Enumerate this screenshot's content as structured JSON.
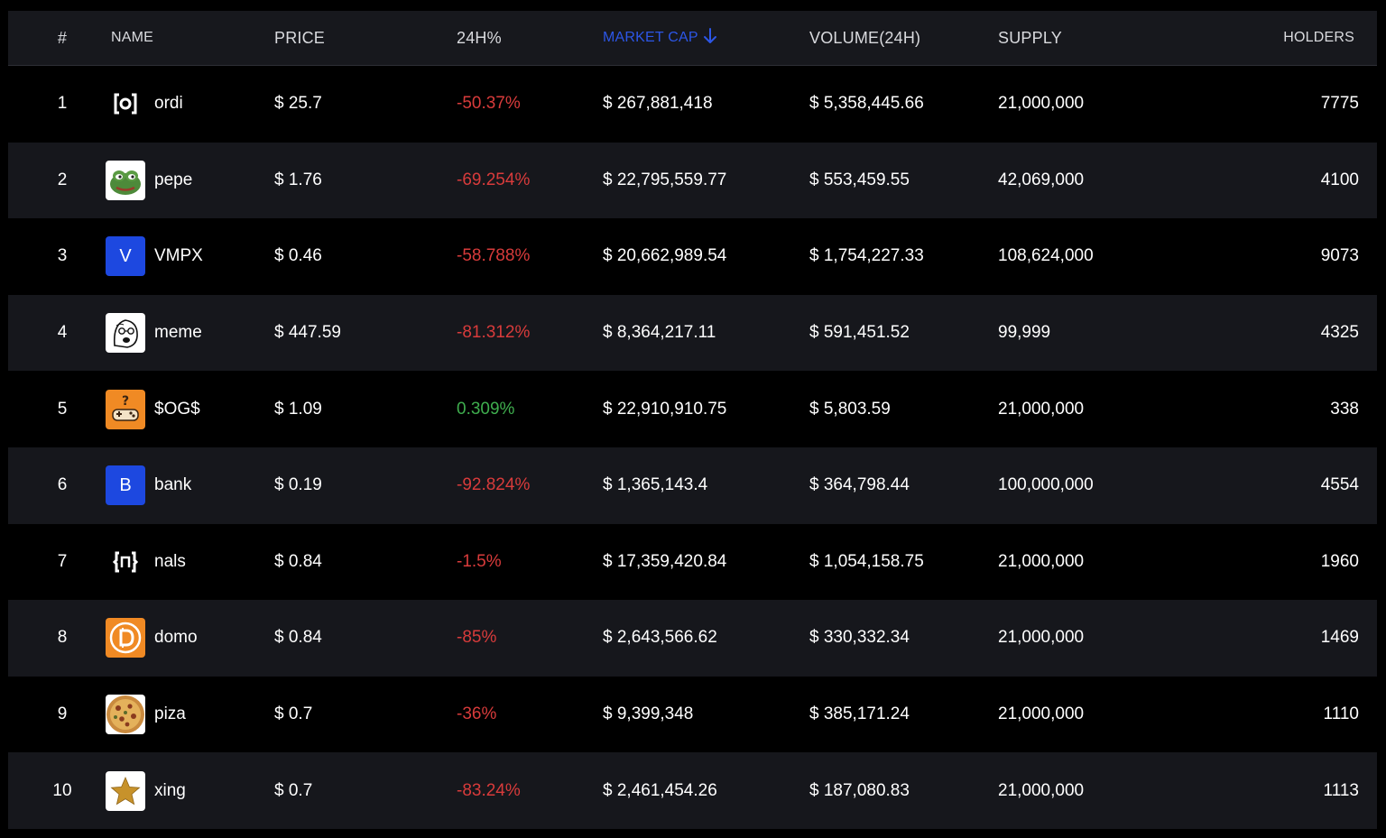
{
  "header": {
    "rank": "#",
    "name": "NAME",
    "price": "PRICE",
    "change": "24H%",
    "market_cap": "MARKET CAP",
    "volume": "VOLUME(24H)",
    "supply": "SUPPLY",
    "holders": "HOLDERS"
  },
  "colors": {
    "accent": "#2c56e6",
    "negative": "#d83b3b",
    "positive": "#3fae4e",
    "row_alt": "#16171c",
    "header_bg": "#17181d"
  },
  "rows": [
    {
      "rank": "1",
      "name": "ordi",
      "icon": "ordi-bracket-icon",
      "price": "$ 25.7",
      "change": "-50.37%",
      "direction": "neg",
      "market_cap": "$ 267,881,418",
      "volume": "$ 5,358,445.66",
      "supply": "21,000,000",
      "holders": "7775"
    },
    {
      "rank": "2",
      "name": "pepe",
      "icon": "pepe-frog-icon",
      "price": "$ 1.76",
      "change": "-69.254%",
      "direction": "neg",
      "market_cap": "$ 22,795,559.77",
      "volume": "$ 553,459.55",
      "supply": "42,069,000",
      "holders": "4100"
    },
    {
      "rank": "3",
      "name": "VMPX",
      "icon": "letter-v-icon",
      "icon_letter": "V",
      "price": "$ 0.46",
      "change": "-58.788%",
      "direction": "neg",
      "market_cap": "$ 20,662,989.54",
      "volume": "$ 1,754,227.33",
      "supply": "108,624,000",
      "holders": "9073"
    },
    {
      "rank": "4",
      "name": "meme",
      "icon": "meme-face-icon",
      "price": "$ 447.59",
      "change": "-81.312%",
      "direction": "neg",
      "market_cap": "$ 8,364,217.11",
      "volume": "$ 591,451.52",
      "supply": "99,999",
      "holders": "4325"
    },
    {
      "rank": "5",
      "name": "$OG$",
      "icon": "game-controller-question-icon",
      "price": "$ 1.09",
      "change": "0.309%",
      "direction": "pos",
      "market_cap": "$ 22,910,910.75",
      "volume": "$ 5,803.59",
      "supply": "21,000,000",
      "holders": "338"
    },
    {
      "rank": "6",
      "name": "bank",
      "icon": "letter-b-icon",
      "icon_letter": "B",
      "price": "$ 0.19",
      "change": "-92.824%",
      "direction": "neg",
      "market_cap": "$ 1,365,143.4",
      "volume": "$ 364,798.44",
      "supply": "100,000,000",
      "holders": "4554"
    },
    {
      "rank": "7",
      "name": "nals",
      "icon": "nals-bracket-icon",
      "price": "$ 0.84",
      "change": "-1.5%",
      "direction": "neg",
      "market_cap": "$ 17,359,420.84",
      "volume": "$ 1,054,158.75",
      "supply": "21,000,000",
      "holders": "1960"
    },
    {
      "rank": "8",
      "name": "domo",
      "icon": "domo-coin-icon",
      "price": "$ 0.84",
      "change": "-85%",
      "direction": "neg",
      "market_cap": "$ 2,643,566.62",
      "volume": "$ 330,332.34",
      "supply": "21,000,000",
      "holders": "1469"
    },
    {
      "rank": "9",
      "name": "piza",
      "icon": "pizza-icon",
      "price": "$ 0.7",
      "change": "-36%",
      "direction": "neg",
      "market_cap": "$ 9,399,348",
      "volume": "$ 385,171.24",
      "supply": "21,000,000",
      "holders": "1110"
    },
    {
      "rank": "10",
      "name": "xing",
      "icon": "gold-star-icon",
      "price": "$ 0.7",
      "change": "-83.24%",
      "direction": "neg",
      "market_cap": "$ 2,461,454.26",
      "volume": "$ 187,080.83",
      "supply": "21,000,000",
      "holders": "1113"
    }
  ]
}
